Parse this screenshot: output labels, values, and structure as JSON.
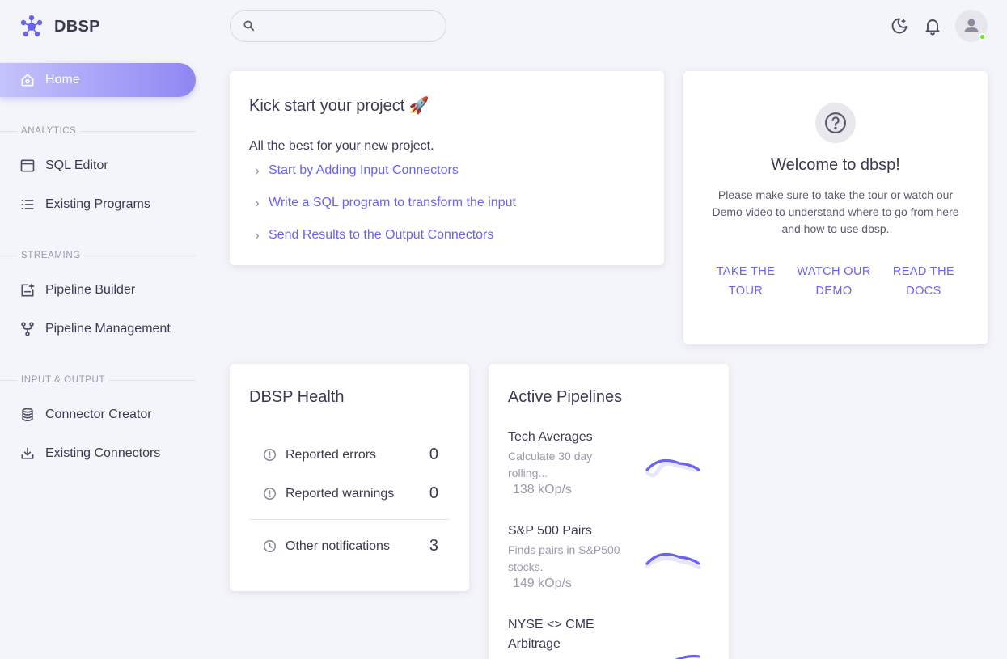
{
  "brand": {
    "name": "DBSP"
  },
  "sidebar": {
    "home": "Home",
    "sections": [
      {
        "title": "ANALYTICS",
        "items": [
          "SQL Editor",
          "Existing Programs"
        ]
      },
      {
        "title": "STREAMING",
        "items": [
          "Pipeline Builder",
          "Pipeline Management"
        ]
      },
      {
        "title": "INPUT & OUTPUT",
        "items": [
          "Connector Creator",
          "Existing Connectors"
        ]
      }
    ]
  },
  "search": {
    "placeholder": ""
  },
  "kickstart": {
    "title": "Kick start your project 🚀",
    "subtitle": "All the best for your new project.",
    "steps": [
      "Start by Adding Input Connectors",
      "Write a SQL program to transform the input",
      "Send Results to the Output Connectors"
    ]
  },
  "welcome": {
    "title": "Welcome to dbsp!",
    "text": "Please make sure to take the tour or watch our Demo video to understand where to go from here and how to use dbsp.",
    "buttons": [
      "TAKE THE TOUR",
      "WATCH OUR DEMO",
      "READ THE DOCS"
    ]
  },
  "health": {
    "title": "DBSP Health",
    "rows": [
      {
        "label": "Reported errors",
        "value": "0"
      },
      {
        "label": "Reported warnings",
        "value": "0"
      },
      {
        "label": "Other notifications",
        "value": "3"
      }
    ]
  },
  "pipelines": {
    "title": "Active Pipelines",
    "items": [
      {
        "name": "Tech Averages",
        "desc": "Calculate 30 day rolling...",
        "rate": "138 kOp/s"
      },
      {
        "name": "S&P 500 Pairs",
        "desc": "Finds pairs in S&P500 stocks.",
        "rate": "149 kOp/s"
      },
      {
        "name": "NYSE <> CME Arbitrage",
        "desc": "",
        "rate": ""
      }
    ]
  },
  "colors": {
    "accent": "#6a63f0",
    "status_online": "#72e128"
  }
}
